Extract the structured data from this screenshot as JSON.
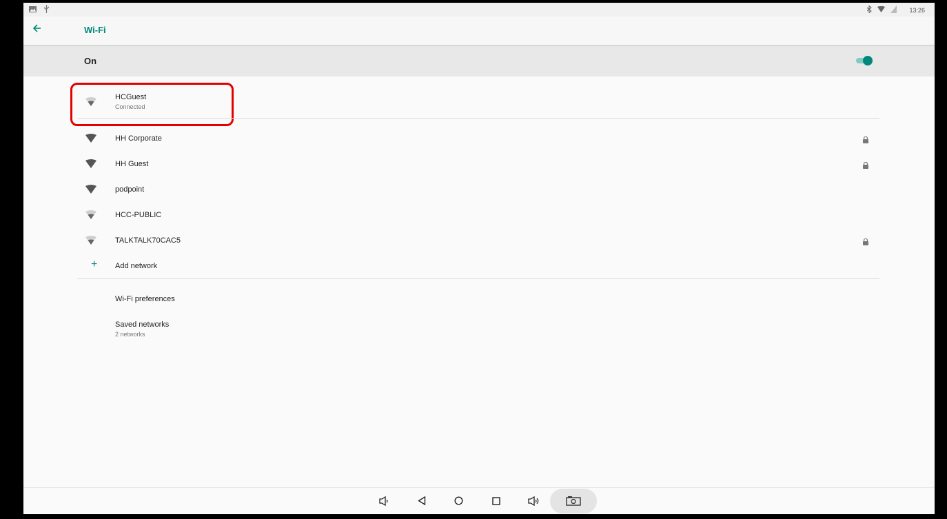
{
  "status_bar": {
    "time": "13:26",
    "left_icons": [
      "image-icon",
      "usb-icon"
    ],
    "right_icons": [
      "bluetooth-icon",
      "wifi-icon",
      "battery-icon"
    ]
  },
  "app_bar": {
    "title": "Wi-Fi",
    "back_icon": "arrow-left-icon"
  },
  "master_switch": {
    "label": "On",
    "state": true,
    "accent": "#00897b"
  },
  "connected_network": {
    "name": "HCGuest",
    "status": "Connected"
  },
  "networks": [
    {
      "name": "HH Corporate",
      "secured": true,
      "signal": "full"
    },
    {
      "name": "HH Guest",
      "secured": true,
      "signal": "full"
    },
    {
      "name": "podpoint",
      "secured": false,
      "signal": "full"
    },
    {
      "name": "HCC-PUBLIC",
      "secured": false,
      "signal": "weak"
    },
    {
      "name": "TALKTALK70CAC5",
      "secured": true,
      "signal": "weak"
    }
  ],
  "add_network": {
    "label": "Add network"
  },
  "preferences": {
    "wifi_preferences": "Wi-Fi preferences",
    "saved_networks": "Saved networks",
    "saved_networks_count": "2 networks"
  },
  "nav_bar": {
    "buttons": [
      "volume-down-icon",
      "back-icon",
      "home-icon",
      "recents-icon",
      "volume-up-icon",
      "screenshot-icon"
    ]
  },
  "colors": {
    "accent": "#00897b",
    "highlight": "#e30000"
  }
}
